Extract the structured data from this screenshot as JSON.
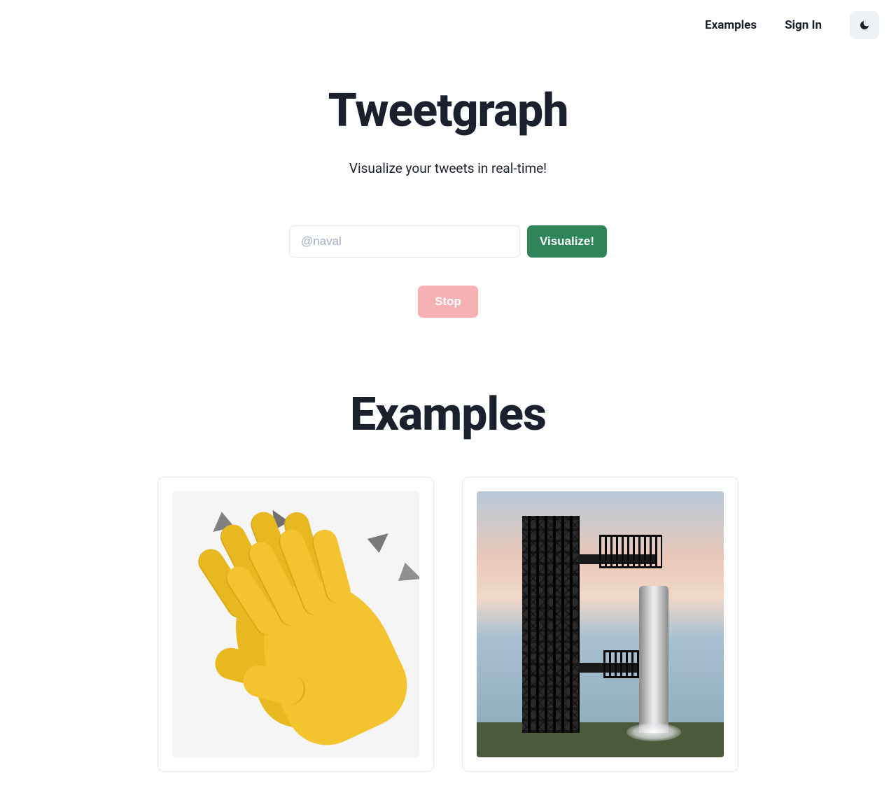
{
  "nav": {
    "examples": "Examples",
    "signin": "Sign In"
  },
  "hero": {
    "title": "Tweetgraph",
    "subtitle": "Visualize your tweets in real-time!",
    "input_placeholder": "@naval",
    "visualize_label": "Visualize!",
    "stop_label": "Stop"
  },
  "examples": {
    "heading": "Examples",
    "cards": [
      {
        "image": "clapping-hands"
      },
      {
        "image": "rocket-launchpad"
      }
    ]
  }
}
